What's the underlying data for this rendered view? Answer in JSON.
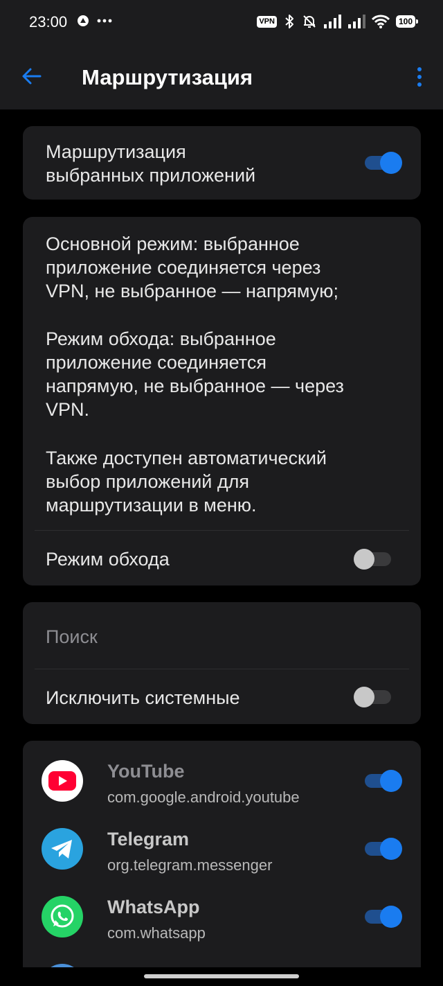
{
  "status_bar": {
    "time": "23:00",
    "vpn_badge": "VPN",
    "battery": "100",
    "icons": [
      "notification-circle-icon",
      "more-dots-icon",
      "bluetooth-icon",
      "mute-bell-icon",
      "signal-icon",
      "signal-icon",
      "wifi-icon"
    ]
  },
  "app_bar": {
    "title": "Маршрутизация",
    "back_icon": "arrow-left-icon",
    "menu_icon": "more-vertical-icon",
    "accent": "#1a7cf0"
  },
  "routing_card": {
    "label_line1": "Маршрутизация",
    "label_line2": "выбранных приложений",
    "enabled": true
  },
  "info_card": {
    "para1": [
      "Основной режим: выбранное",
      "приложение соединяется через",
      "VPN, не выбранное — напрямую;"
    ],
    "para2": [
      "Режим обхода: выбранное",
      "приложение соединяется",
      "напрямую, не выбранное — через",
      "VPN."
    ],
    "para3": [
      "Также доступен автоматический",
      "выбор приложений для",
      "маршрутизации в меню."
    ],
    "bypass_label": "Режим обхода",
    "bypass_enabled": false
  },
  "search_card": {
    "placeholder": "Поиск",
    "exclude_system_label": "Исключить системные",
    "exclude_system_enabled": false
  },
  "apps": [
    {
      "name": "YouTube",
      "package": "com.google.android.youtube",
      "enabled": true,
      "icon": "youtube-icon",
      "color": "#ff0033"
    },
    {
      "name": "Telegram",
      "package": "org.telegram.messenger",
      "enabled": true,
      "icon": "telegram-icon",
      "color": "#2aa3df"
    },
    {
      "name": "WhatsApp",
      "package": "com.whatsapp",
      "enabled": true,
      "icon": "whatsapp-icon",
      "color": "#25d366"
    }
  ]
}
